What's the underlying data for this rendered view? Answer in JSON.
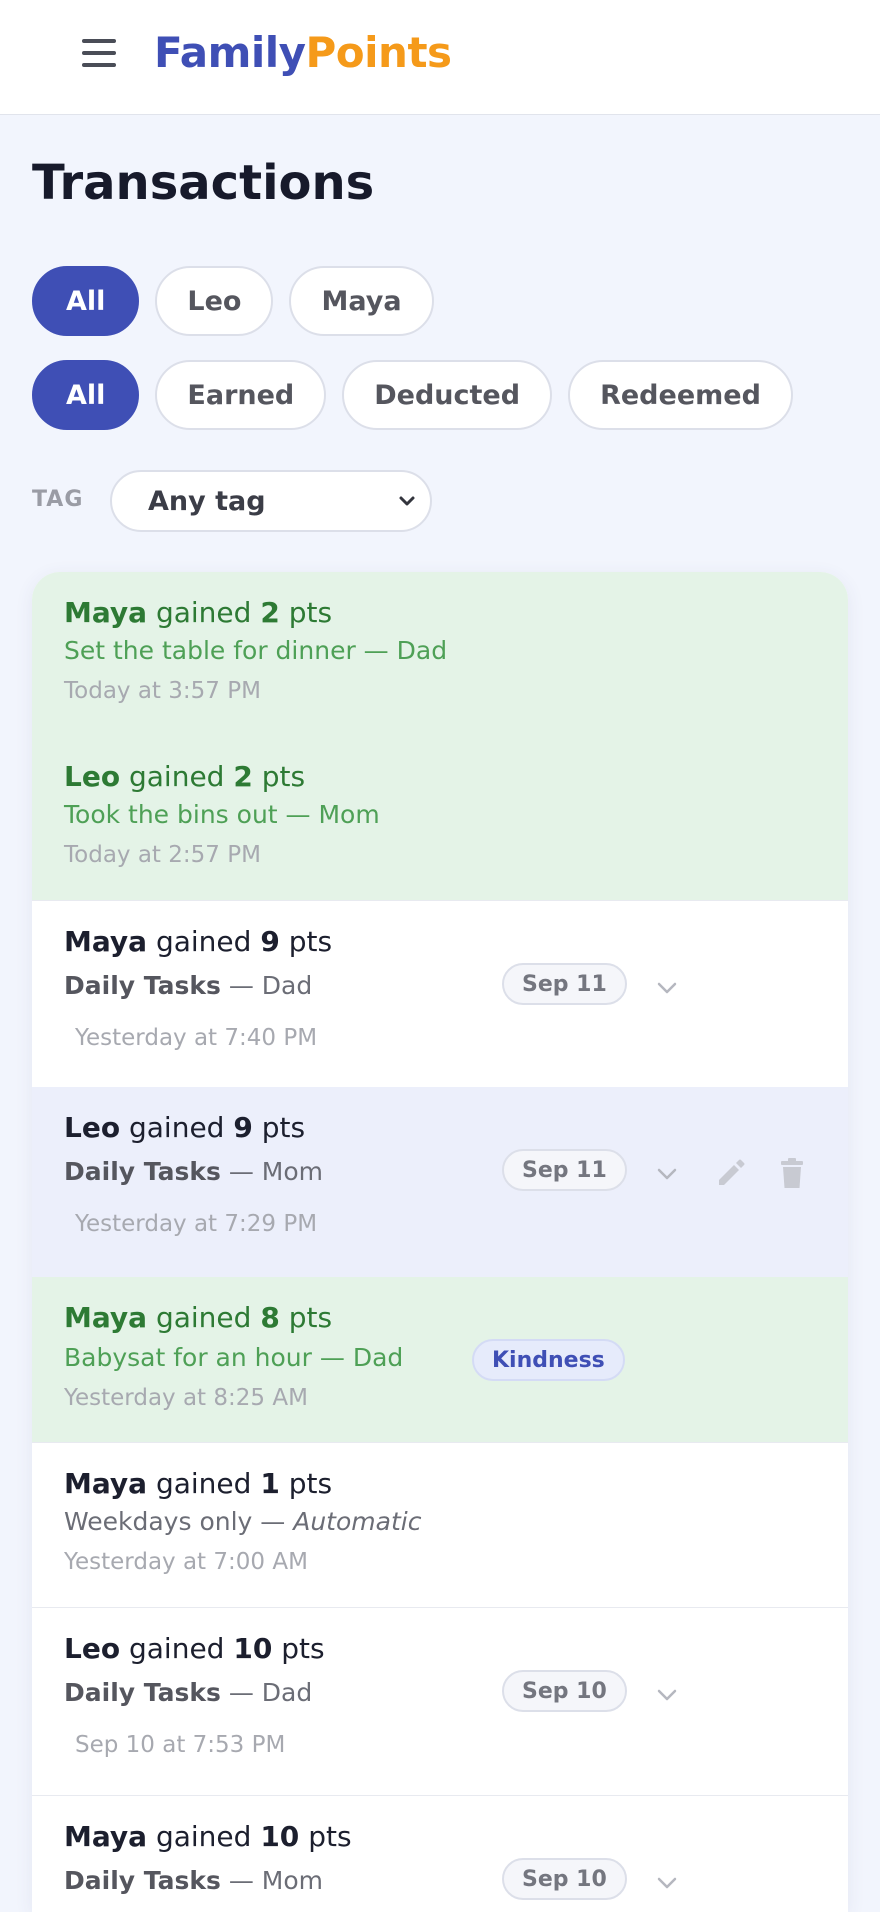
{
  "app": {
    "logo_part1": "Family",
    "logo_part2": "Points"
  },
  "page": {
    "title": "Transactions"
  },
  "filters": {
    "members": [
      "All",
      "Leo",
      "Maya"
    ],
    "types": [
      "All",
      "Earned",
      "Deducted",
      "Redeemed"
    ],
    "tag_label": "TAG",
    "tag_value": "Any tag"
  },
  "transactions": [
    {
      "name": "Maya",
      "verb": "gained",
      "points": "2",
      "unit": "pts",
      "desc": "Set the table for dinner — Dad",
      "time": "Today at 3:57 PM"
    },
    {
      "name": "Leo",
      "verb": "gained",
      "points": "2",
      "unit": "pts",
      "desc": "Took the bins out — Mom",
      "time": "Today at 2:57 PM"
    },
    {
      "name": "Maya",
      "verb": "gained",
      "points": "9",
      "unit": "pts",
      "category": "Daily Tasks",
      "by": "— Dad",
      "date_badge": "Sep 11",
      "time": "Yesterday at 7:40 PM"
    },
    {
      "name": "Leo",
      "verb": "gained",
      "points": "9",
      "unit": "pts",
      "category": "Daily Tasks",
      "by": "— Mom",
      "date_badge": "Sep 11",
      "time": "Yesterday at 7:29 PM"
    },
    {
      "name": "Maya",
      "verb": "gained",
      "points": "8",
      "unit": "pts",
      "desc": "Babysat for an hour — Dad",
      "tag": "Kindness",
      "time": "Yesterday at 8:25 AM"
    },
    {
      "name": "Maya",
      "verb": "gained",
      "points": "1",
      "unit": "pts",
      "desc": "Weekdays only —",
      "by": "Automatic",
      "time": "Yesterday at 7:00 AM"
    },
    {
      "name": "Leo",
      "verb": "gained",
      "points": "10",
      "unit": "pts",
      "category": "Daily Tasks",
      "by": "— Dad",
      "date_badge": "Sep 10",
      "time": "Sep 10 at 7:53 PM"
    },
    {
      "name": "Maya",
      "verb": "gained",
      "points": "10",
      "unit": "pts",
      "category": "Daily Tasks",
      "by": "— Mom",
      "date_badge": "Sep 10"
    }
  ],
  "colors": {
    "brand_blue": "#3f4fb5",
    "brand_orange": "#f59a1a",
    "earned_bg": "#e4f3e7",
    "earned_text": "#2d7a34"
  }
}
